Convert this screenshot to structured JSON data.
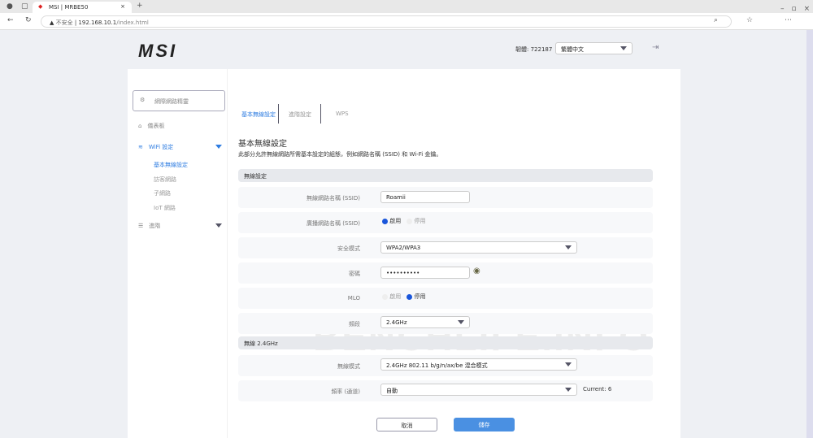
{
  "browser": {
    "tab_title": "MSI | MRBE50",
    "security": "不安全",
    "url_host": "192.168.10.1",
    "url_path": "/index.html"
  },
  "header": {
    "logo": "MSI",
    "firmware": "韌體: 722187",
    "language": "繁體中文"
  },
  "sidebar": {
    "wizard": "網際網路精靈",
    "dashboard": "儀表板",
    "wifi": "WiFi 設定",
    "wifi_sub": [
      "基本無線設定",
      "訪客網路",
      "子網路",
      "IoT 網路"
    ],
    "advanced": "進階"
  },
  "tabs": [
    "基本無線設定",
    "進階設定",
    "WPS"
  ],
  "page": {
    "title": "基本無線設定",
    "description": "此部分允許無線網路所需基本設定的組態，例如網路名稱 (SSID) 和 Wi-Fi 金鑰。"
  },
  "section1": {
    "title": "無線設定",
    "ssid_label": "無線網路名稱 (SSID)",
    "ssid": "Roamii",
    "broadcast_label": "廣播網路名稱 (SSID)",
    "enable": "啟用",
    "disable": "停用",
    "security_label": "安全模式",
    "security": "WPA2/WPA3",
    "password_label": "密碼",
    "password": "••••••••••",
    "mlo_label": "MLO",
    "band_label": "頻段",
    "band": "2.4GHz"
  },
  "section2": {
    "title": "無線 2.4GHz",
    "mode_label": "無線模式",
    "mode": "2.4GHz 802.11 b/g/n/ax/be 混合模式",
    "channel_label": "頻率 (通道)",
    "channel": "自動",
    "current": "Current: 6"
  },
  "buttons": {
    "cancel": "取消",
    "save": "儲存"
  },
  "watermark": "BENCHLIFE.INFO",
  "colors": {
    "accent": "#2f7de1",
    "save": "#4a90e2"
  }
}
